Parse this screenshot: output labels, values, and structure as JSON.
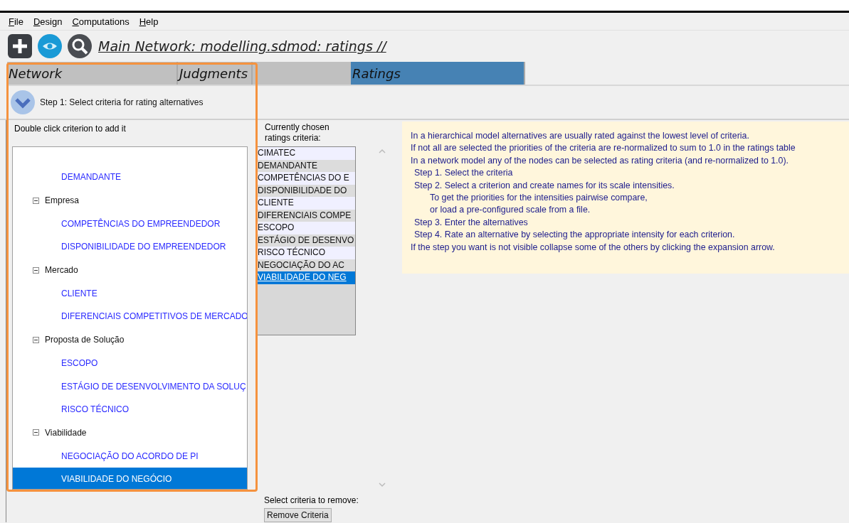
{
  "menu": [
    {
      "label": "File"
    },
    {
      "label": "Design"
    },
    {
      "label": "Computations"
    },
    {
      "label": "Help"
    }
  ],
  "toolbar": {
    "title": "Main Network: modelling.sdmod: ratings //"
  },
  "tabs": [
    {
      "label": "Network",
      "selected": false
    },
    {
      "label": "Judgments",
      "selected": false
    },
    {
      "label": "Ratings",
      "selected": true
    }
  ],
  "step": {
    "label": "Step 1: Select criteria for rating alternatives",
    "expanded": true
  },
  "tree": {
    "caption": "Double click criterion to add it",
    "items": [
      {
        "kind": "leaf",
        "label": "DEMANDANTE",
        "selected": false
      },
      {
        "kind": "category",
        "label": "Empresa",
        "expanded": true,
        "children": [
          {
            "kind": "leaf",
            "label": "COMPETÊNCIAS DO EMPREENDEDOR",
            "selected": false
          },
          {
            "kind": "leaf",
            "label": "DISPONIBILIDADE DO EMPREENDEDOR",
            "selected": false
          }
        ]
      },
      {
        "kind": "category",
        "label": "Mercado",
        "expanded": true,
        "children": [
          {
            "kind": "leaf",
            "label": "CLIENTE",
            "selected": false
          },
          {
            "kind": "leaf",
            "label": "DIFERENCIAIS COMPETITIVOS DE MERCADO",
            "selected": false
          }
        ]
      },
      {
        "kind": "category",
        "label": "Proposta de Solução",
        "expanded": true,
        "children": [
          {
            "kind": "leaf",
            "label": "ESCOPO",
            "selected": false
          },
          {
            "kind": "leaf",
            "label": "ESTÁGIO DE DESENVOLVIMENTO DA SOLUÇ",
            "selected": false
          },
          {
            "kind": "leaf",
            "label": "RISCO TÉCNICO",
            "selected": false
          }
        ]
      },
      {
        "kind": "category",
        "label": "Viabilidade",
        "expanded": true,
        "children": [
          {
            "kind": "leaf",
            "label": "NEGOCIAÇÃO DO ACORDO DE PI",
            "selected": false
          },
          {
            "kind": "leaf",
            "label": "VIABILIDADE DO NEGÓCIO",
            "selected": true
          }
        ]
      }
    ]
  },
  "chosen": {
    "caption": "Currently chosen ratings criteria:",
    "items": [
      {
        "label": "CIMATEC",
        "selected": false
      },
      {
        "label": "DEMANDANTE",
        "selected": false
      },
      {
        "label": "COMPETÊNCIAS DO E",
        "selected": false
      },
      {
        "label": "DISPONIBILIDADE DO",
        "selected": false
      },
      {
        "label": "CLIENTE",
        "selected": false
      },
      {
        "label": "DIFERENCIAIS COMPE",
        "selected": false
      },
      {
        "label": "ESCOPO",
        "selected": false
      },
      {
        "label": "ESTÁGIO DE DESENVO",
        "selected": false
      },
      {
        "label": "RISCO TÉCNICO",
        "selected": false
      },
      {
        "label": "NEGOCIAÇÃO DO AC",
        "selected": false
      },
      {
        "label": "VIABILIDADE DO NEG",
        "selected": true
      }
    ]
  },
  "info": {
    "lines": [
      {
        "kind": "note",
        "text": "In a hierarchical model alternatives are usually rated against the lowest level of criteria."
      },
      {
        "kind": "note",
        "text": "If not all are selected the priorities of the criteria are re-normalized to sum to 1.0 in the ratings table"
      },
      {
        "kind": "note",
        "text": "In a network model any of the nodes can be selected as rating criteria (and re-normalized to 1.0)."
      },
      {
        "kind": "step",
        "text": "Step 1. Select the criteria"
      },
      {
        "kind": "step",
        "text": "Step 2. Select a criterion and create names for its scale intensities."
      },
      {
        "kind": "substep",
        "text": "To get the priorities for the intensities pairwise compare,"
      },
      {
        "kind": "substep",
        "text": "or load a pre-configured scale from a file."
      },
      {
        "kind": "step",
        "text": "Step 3. Enter the alternatives"
      },
      {
        "kind": "step",
        "text": "Step 4. Rate an alternative by selecting the appropriate intensity for each criterion."
      },
      {
        "kind": "note",
        "text": "If the step you want is not visible collapse some of the others by clicking the expansion arrow."
      }
    ]
  },
  "remove": {
    "caption": "Select criteria to remove:",
    "button": "Remove Criteria"
  }
}
